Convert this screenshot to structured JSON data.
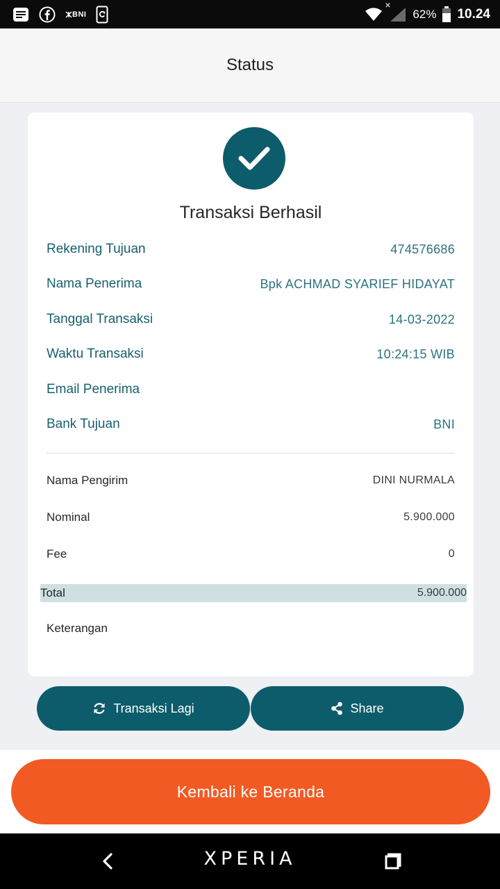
{
  "status_bar": {
    "icons": [
      "news-icon",
      "facebook-icon",
      "bni-icon",
      "clipboard-icon",
      "wifi-icon",
      "signal-icon",
      "battery-icon"
    ],
    "bni_label": "BNI",
    "no_signal_mark": "×",
    "battery": "62%",
    "time": "10.24"
  },
  "header": {
    "title": "Status"
  },
  "receipt": {
    "status_icon": "check-icon",
    "title": "Transaksi Berhasil",
    "recipient_details": [
      {
        "label": "Rekening Tujuan",
        "value": "474576686"
      },
      {
        "label": "Nama Penerima",
        "value": "Bpk ACHMAD SYARIEF HIDAYAT"
      },
      {
        "label": "Tanggal Transaksi",
        "value": "14-03-2022"
      },
      {
        "label": "Waktu Transaksi",
        "value": "10:24:15 WIB"
      },
      {
        "label": "Email Penerima",
        "value": ""
      },
      {
        "label": "Bank Tujuan",
        "value": "BNI"
      }
    ],
    "payment_details": [
      {
        "label": "Nama Pengirim",
        "value": "DINI NURMALA"
      },
      {
        "label": "Nominal",
        "value": "5.900.000"
      },
      {
        "label": "Fee",
        "value": "0"
      }
    ],
    "total": {
      "label": "Total",
      "value": "5.900.000"
    },
    "note": {
      "label": "Keterangan",
      "value": ""
    }
  },
  "actions": {
    "transact_again": {
      "label": "Transaksi Lagi",
      "icon": "refresh-icon"
    },
    "share": {
      "label": "Share",
      "icon": "share-icon"
    }
  },
  "home_button": {
    "label": "Kembali ke Beranda"
  },
  "nav_bar": {
    "brand": "XPERIA",
    "icons": [
      "back-icon",
      "recent-apps-icon"
    ]
  },
  "colors": {
    "primary": "#0d5c6b",
    "accent": "#f25a24",
    "total_highlight": "#cfe0e2",
    "label_teal": "#17606e"
  }
}
